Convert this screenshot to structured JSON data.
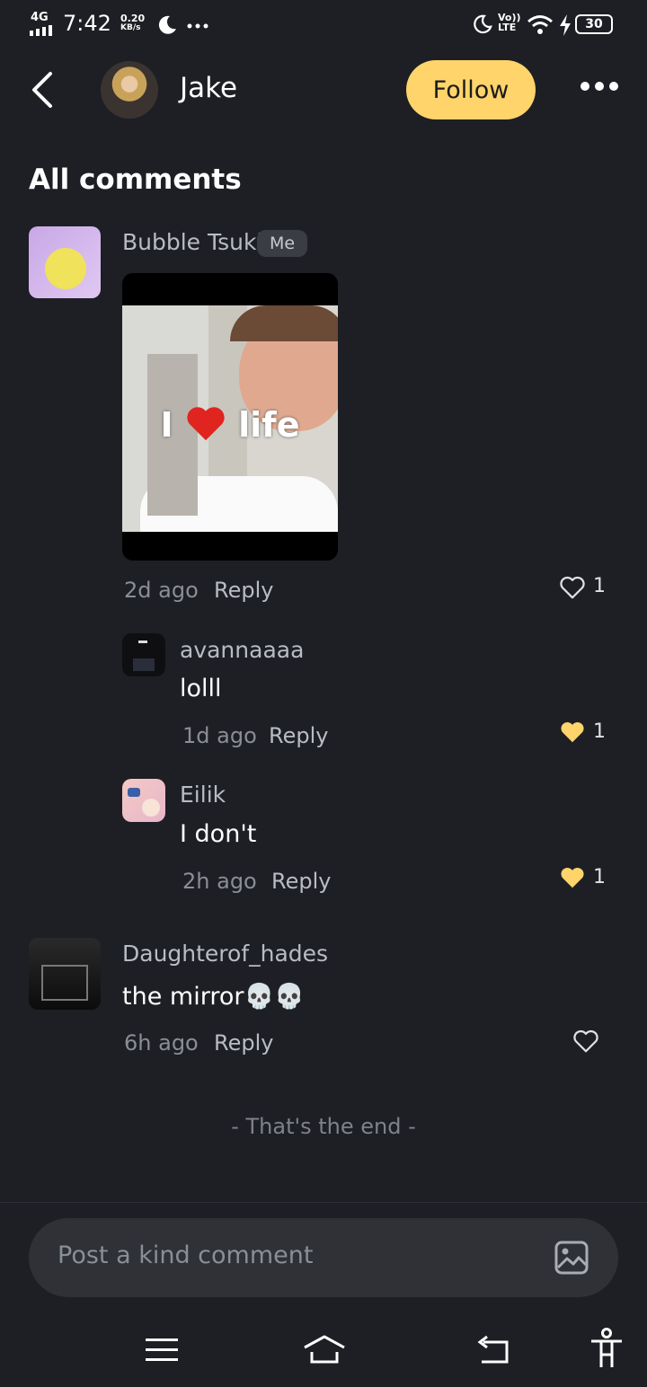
{
  "status_bar": {
    "network": "4G",
    "time": "7:42",
    "speed_value": "0.20",
    "speed_unit": "KB/s",
    "volte": "Vo)) LTE",
    "battery": "30"
  },
  "header": {
    "user_name": "Jake",
    "follow_label": "Follow"
  },
  "section_title": "All comments",
  "comments": [
    {
      "user": "Bubble Tsuki",
      "badge": "Me",
      "image_overlay_left": "I",
      "image_overlay_right": "life",
      "time": "2d ago",
      "reply_label": "Reply",
      "likes": "1",
      "liked": false,
      "replies": [
        {
          "user": "avannaaaa",
          "text": "lolll",
          "time": "1d ago",
          "reply_label": "Reply",
          "likes": "1",
          "liked": true
        },
        {
          "user": "Eilik",
          "text": "I don't",
          "time": "2h ago",
          "reply_label": "Reply",
          "likes": "1",
          "liked": true
        }
      ]
    },
    {
      "user": "Daughterof_hades",
      "text": "the mirror💀💀",
      "time": "6h ago",
      "reply_label": "Reply",
      "likes": "",
      "liked": false
    }
  ],
  "end_text": "- That's the end -",
  "input": {
    "placeholder": "Post a kind comment"
  },
  "colors": {
    "background": "#1d1f24",
    "accent": "#ffd46b",
    "liked_heart": "#ffd46b"
  },
  "icons": [
    "back-chevron-icon",
    "more-dots-icon",
    "heart-outline-icon",
    "heart-filled-icon",
    "image-icon",
    "menu-icon",
    "home-icon",
    "back-icon",
    "accessibility-icon"
  ]
}
